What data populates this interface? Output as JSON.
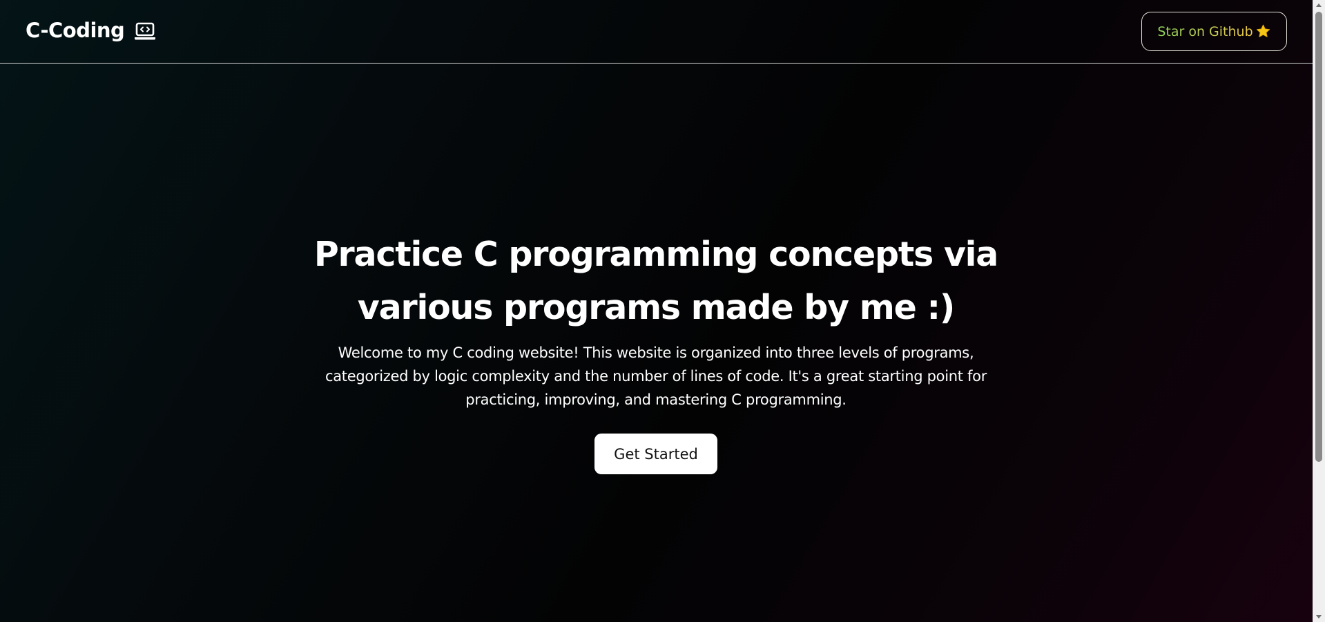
{
  "navbar": {
    "brand": "C-Coding",
    "brand_icon": "laptop-code-icon",
    "github_button": {
      "label": "Star on Github",
      "icon": "star-icon"
    }
  },
  "hero": {
    "title": "Practice C programming concepts via various programs made by me :)",
    "subtitle": "Welcome to my C coding website! This website is organized into three levels of programs, categorized by logic complexity and the number of lines of code. It's a great starting point for practicing, improving, and mastering C programming.",
    "cta_label": "Get Started"
  },
  "colors": {
    "background_left": "#041417",
    "background_mid": "#030304",
    "background_right": "#18010f",
    "star": "#f5c518",
    "github_label_gradient": [
      "#8fd35a",
      "#f0c94a"
    ],
    "cta_background": "#ffffff"
  }
}
